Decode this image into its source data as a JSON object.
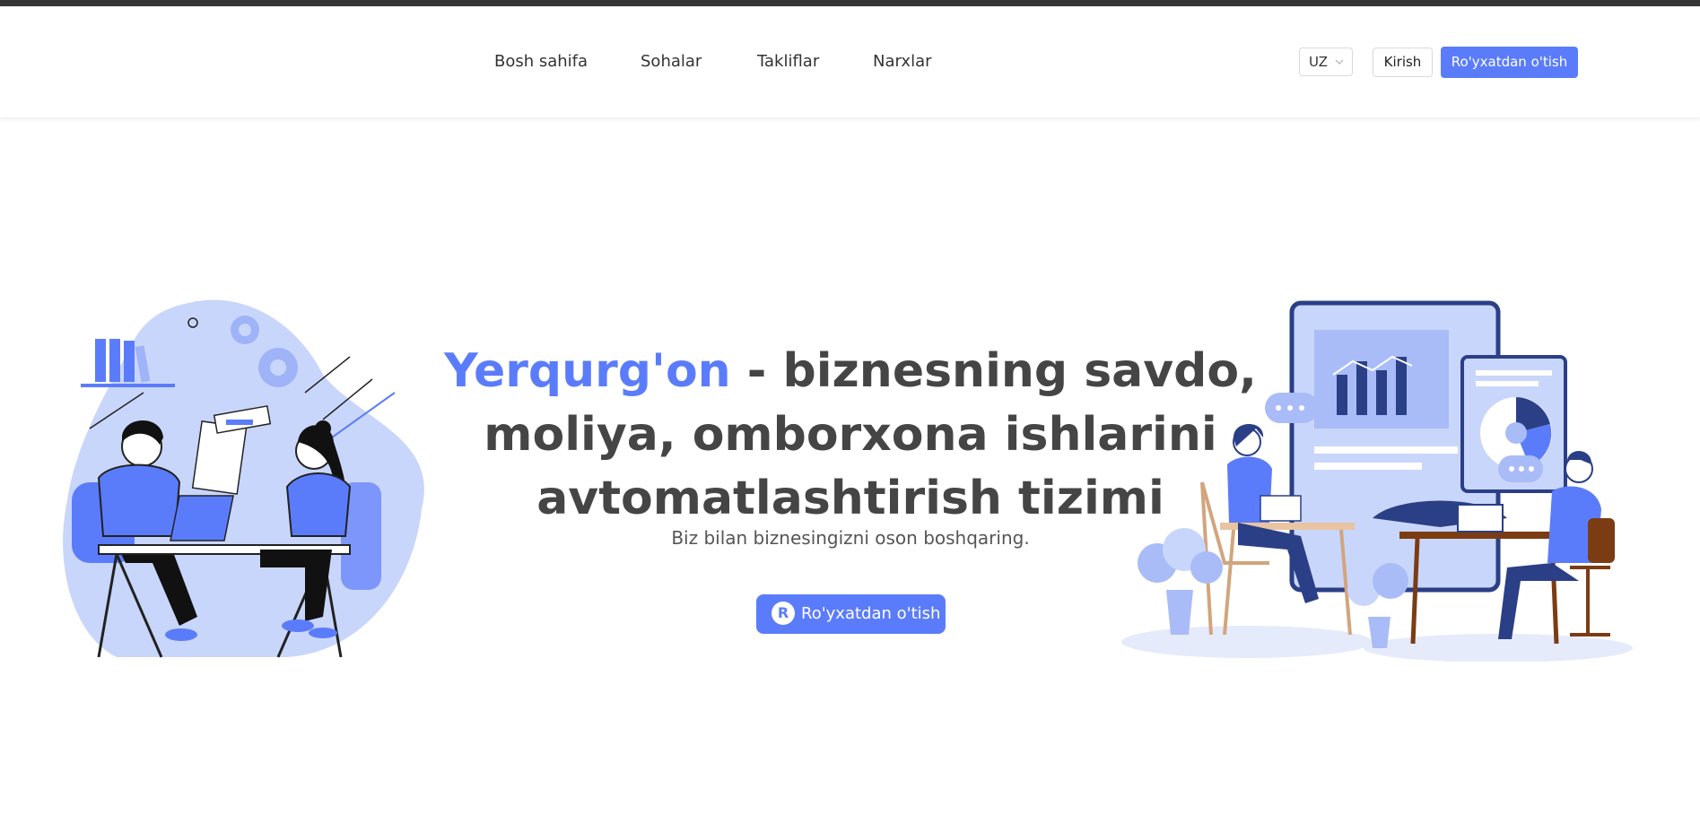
{
  "nav": {
    "items": [
      "Bosh sahifa",
      "Sohalar",
      "Takliflar",
      "Narxlar"
    ]
  },
  "header": {
    "language": "UZ",
    "login_label": "Kirish",
    "register_label": "Ro'yxatdan o'tish"
  },
  "hero": {
    "brand": "Yerqurg'on",
    "title_rest": " - biznesning savdo, moliya, omborxona ishlarini avtomatlashtirish tizimi",
    "subtitle": "Biz bilan biznesingizni oson boshqaring.",
    "cta_icon_letter": "R",
    "cta_label": "Ro'yxatdan o'tish"
  },
  "colors": {
    "accent": "#5b7cfa",
    "topbar": "#353535",
    "text": "#454545"
  }
}
